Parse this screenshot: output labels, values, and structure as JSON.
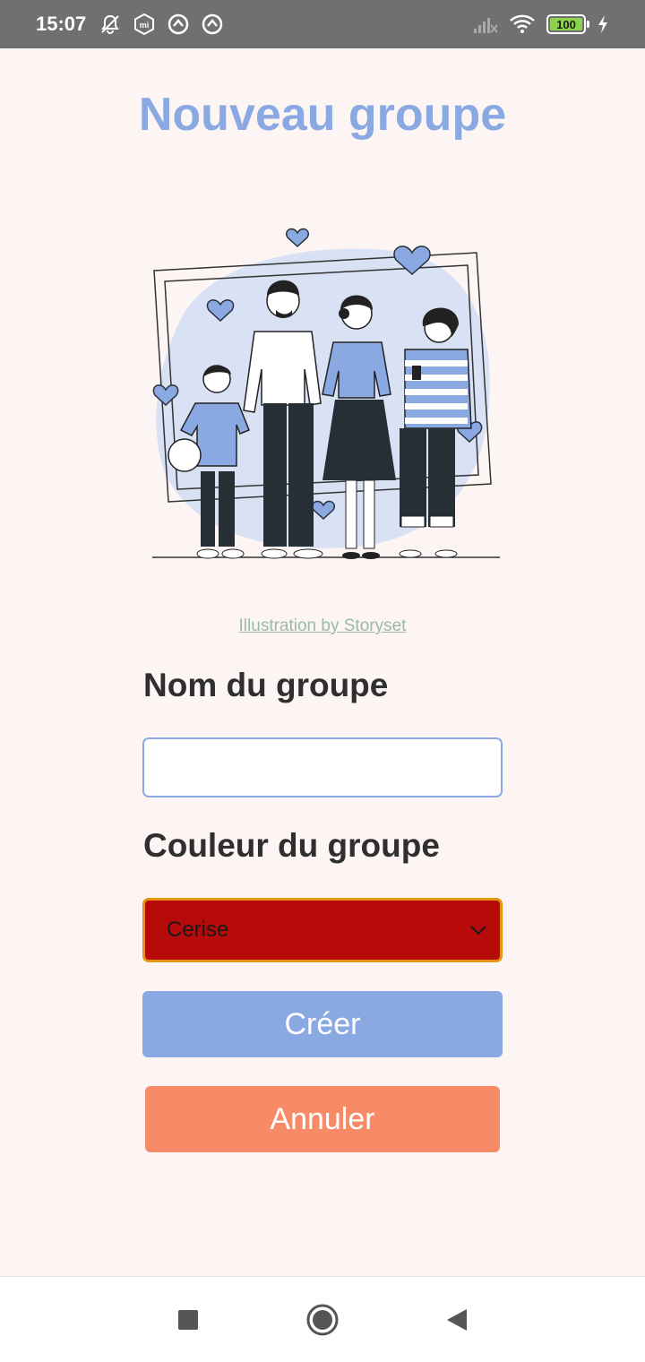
{
  "status_bar": {
    "time": "15:07",
    "battery": "100",
    "icons": [
      "notifications-off-icon",
      "mi-icon",
      "sync-icon",
      "sync-icon",
      "signal-icon",
      "wifi-icon",
      "battery-icon",
      "charging-icon"
    ]
  },
  "page": {
    "title": "Nouveau groupe",
    "credit": "Illustration by Storyset"
  },
  "form": {
    "name_label": "Nom du groupe",
    "name_value": "",
    "color_label": "Couleur du groupe",
    "color_value": "Cerise",
    "color_swatch": "#b70a0a",
    "create_label": "Créer",
    "cancel_label": "Annuler"
  },
  "colors": {
    "accent": "#8aa9e2",
    "cancel": "#f78a67",
    "background": "#fcf5f3"
  },
  "nav_bar": {
    "icons": [
      "recents-icon",
      "home-icon",
      "back-icon"
    ]
  }
}
